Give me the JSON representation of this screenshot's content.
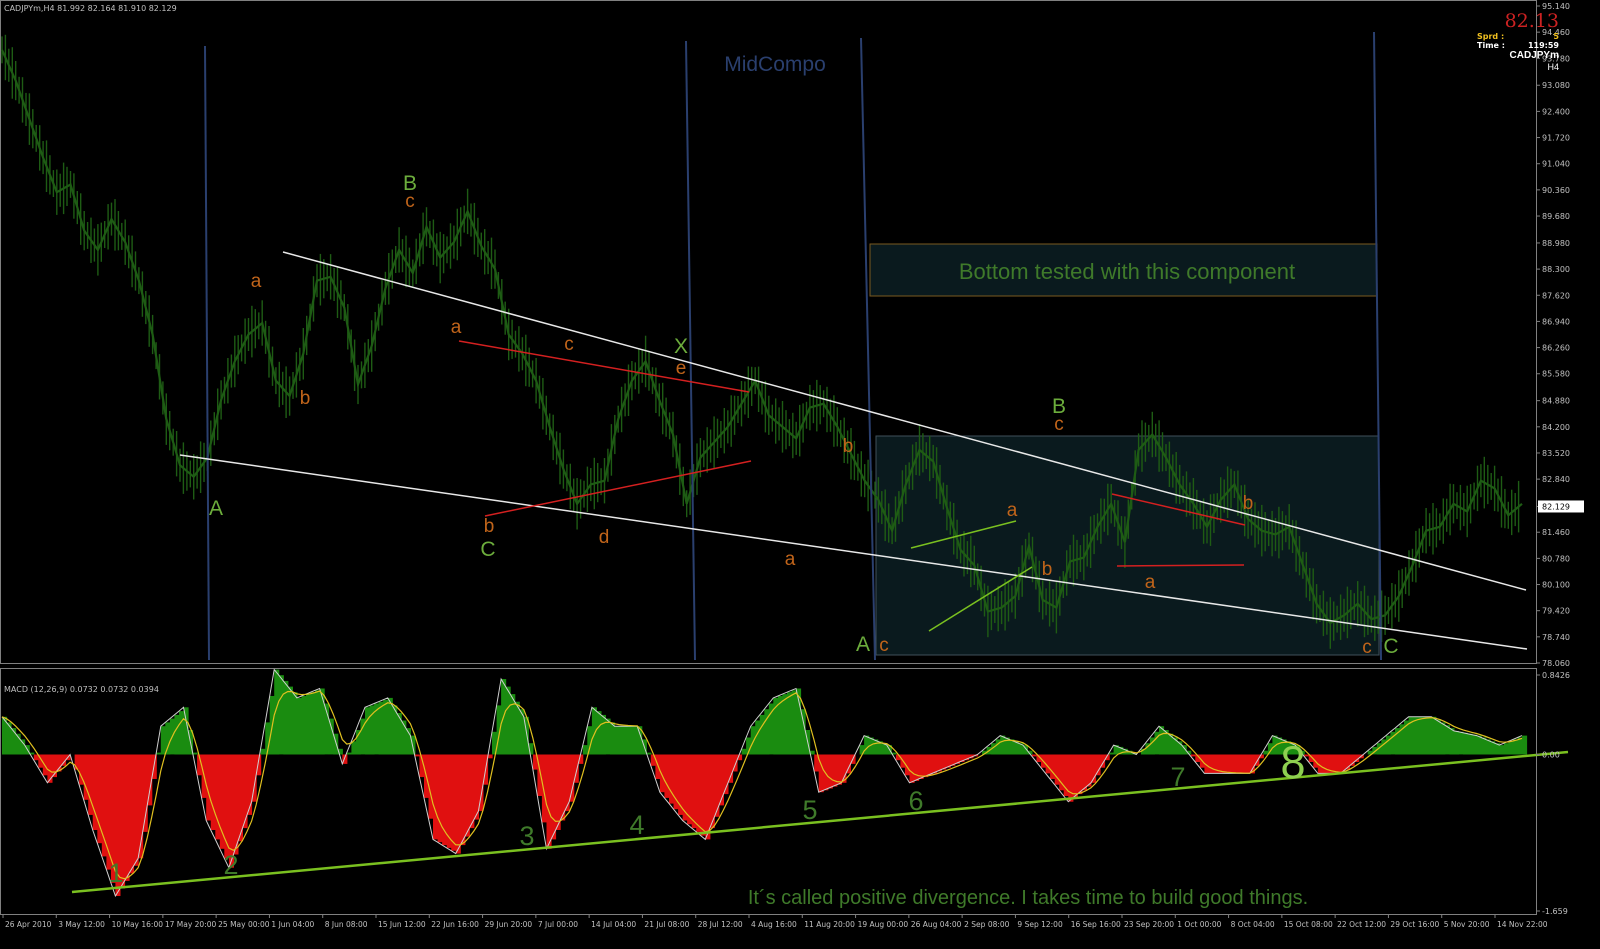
{
  "window": {
    "ohlc_header": "CADJPYm,H4  81.992 82.164 81.910 82.129",
    "macd_header": "MACD (12,26,9) 0.0732 0.0732 0.0394"
  },
  "info_panel": {
    "price": "82.13",
    "spread_label": "Sprd :",
    "spread_value": "5",
    "time_label": "Time :",
    "time_value": "119:59",
    "symbol": "CADJPYm",
    "timeframe": "H4"
  },
  "colors": {
    "background": "#000000",
    "candles": "#1e5c14",
    "wave_green": "#6cad3c",
    "wave_orange": "#c0641a",
    "trendline_white": "#e8e8e8",
    "trendline_red": "#d42020",
    "vertical_lines": "#2a3f6e",
    "macd_positive": "#1a8c10",
    "macd_negative": "#e01010",
    "macd_signal": "#e0c020",
    "divergence_line": "#7ac020",
    "axis_text": "#c0c0c0",
    "annotation_text": "#3f7a2a"
  },
  "chart_data": [
    {
      "type": "line",
      "subtype": "candlestick",
      "title": "CADJPYm,H4",
      "ylim": [
        78.06,
        95.14
      ],
      "y_ticks": [
        "95.140",
        "94.460",
        "93.780",
        "93.080",
        "92.400",
        "91.720",
        "91.040",
        "90.360",
        "89.680",
        "88.980",
        "88.300",
        "87.620",
        "86.940",
        "86.260",
        "85.580",
        "84.880",
        "84.200",
        "83.520",
        "82.840",
        "82.129",
        "81.460",
        "80.780",
        "80.100",
        "79.420",
        "78.740",
        "78.060"
      ],
      "current_price": 82.129,
      "x_ticks": [
        "26 Apr 2010",
        "3 May 12:00",
        "10 May 16:00",
        "17 May 20:00",
        "25 May 00:00",
        "1 Jun 04:00",
        "8 Jun 08:00",
        "15 Jun 12:00",
        "22 Jun 16:00",
        "29 Jun 20:00",
        "7 Jul 00:00",
        "14 Jul 04:00",
        "21 Jul 08:00",
        "28 Jul 12:00",
        "4 Aug 16:00",
        "11 Aug 20:00",
        "19 Aug 00:00",
        "26 Aug 04:00",
        "2 Sep 08:00",
        "9 Sep 12:00",
        "16 Sep 16:00",
        "23 Sep 20:00",
        "1 Oct 00:00",
        "8 Oct 04:00",
        "15 Oct 08:00",
        "22 Oct 12:00",
        "29 Oct 16:00",
        "5 Nov 20:00",
        "14 Nov 22:00"
      ],
      "series": [
        {
          "values": [
            94.0,
            93.2,
            92.2,
            91.2,
            90.3,
            90.5,
            89.3,
            88.8,
            89.6,
            89.0,
            88.0,
            86.6,
            84.4,
            83.2,
            82.9,
            83.4,
            84.9,
            85.9,
            86.6,
            86.9,
            85.4,
            85.0,
            86.1,
            88.0,
            88.1,
            87.3,
            85.3,
            86.3,
            87.8,
            88.8,
            88.2,
            89.4,
            88.6,
            89.0,
            89.8,
            88.9,
            88.3,
            86.6,
            86.1,
            85.4,
            84.2,
            83.1,
            82.2,
            82.7,
            82.8,
            84.4,
            85.4,
            85.9,
            84.9,
            84.0,
            82.2,
            83.4,
            83.8,
            84.2,
            84.8,
            85.4,
            84.5,
            84.2,
            83.9,
            84.7,
            84.8,
            84.2,
            83.5,
            82.8,
            82.3,
            81.5,
            82.7,
            83.6,
            83.3,
            82.1,
            81.0,
            80.6,
            79.4,
            79.5,
            79.8,
            81.1,
            79.7,
            79.5,
            80.7,
            80.8,
            81.6,
            82.2,
            81.2,
            83.6,
            84.0,
            83.4,
            82.7,
            82.2,
            81.6,
            82.3,
            82.7,
            81.8,
            81.5,
            81.4,
            81.6,
            80.6,
            79.6,
            79.1,
            79.3,
            79.6,
            79.2,
            79.3,
            79.8,
            80.6,
            81.5,
            81.6,
            82.2,
            82.0,
            82.8,
            82.6,
            81.9,
            82.2
          ]
        }
      ],
      "annotations": {
        "labels": [
          "MidCompo",
          "Bottom tested with this component"
        ],
        "wave_labels": [
          "A",
          "a",
          "b",
          "B",
          "c",
          "a",
          "c",
          "X",
          "e",
          "b",
          "C",
          "d",
          "b",
          "a",
          "A",
          "c",
          "a",
          "b",
          "B",
          "c",
          "a",
          "b",
          "c",
          "C"
        ],
        "wave_label_values": [
          81.8,
          87.5,
          85.5,
          90.1,
          89.7,
          86.7,
          86.1,
          85.9,
          85.5,
          81.7,
          81.3,
          81.3,
          84.2,
          80.8,
          78.6,
          78.6,
          81.8,
          80.5,
          84.7,
          84.2,
          80.0,
          82.0,
          78.6,
          78.6
        ]
      },
      "grid": false
    },
    {
      "type": "bar",
      "title": "MACD (12,26,9) 0.0732 0.0732 0.0394",
      "ylim": [
        -1.659,
        0.8426
      ],
      "y_ticks": [
        "0.8426",
        "0.00",
        "-1.659"
      ],
      "series": [
        {
          "name": "MACD",
          "values": [
            0.4,
            0.1,
            -0.3,
            0.0,
            -0.8,
            -1.5,
            -1.1,
            0.3,
            0.5,
            -0.7,
            -1.2,
            -0.5,
            0.9,
            0.6,
            0.7,
            -0.1,
            0.5,
            0.6,
            0.2,
            -0.9,
            -1.05,
            -0.6,
            0.8,
            0.4,
            -1.0,
            -0.5,
            0.5,
            0.3,
            0.3,
            -0.4,
            -0.7,
            -0.9,
            -0.3,
            0.3,
            0.6,
            0.7,
            -0.4,
            -0.3,
            0.2,
            0.1,
            -0.3,
            -0.2,
            -0.1,
            0.0,
            0.2,
            0.1,
            -0.2,
            -0.5,
            -0.3,
            0.1,
            0.0,
            0.3,
            0.1,
            -0.2,
            -0.2,
            -0.2,
            0.2,
            0.1,
            -0.2,
            -0.2,
            0.0,
            0.2,
            0.4,
            0.4,
            0.25,
            0.2,
            0.1,
            0.2
          ]
        }
      ],
      "annotations": {
        "divergence_labels": [
          "1",
          "2",
          "3",
          "4",
          "5",
          "6",
          "7",
          "8"
        ],
        "note": "It´s called positive divergence. I takes time to build good things."
      }
    }
  ]
}
